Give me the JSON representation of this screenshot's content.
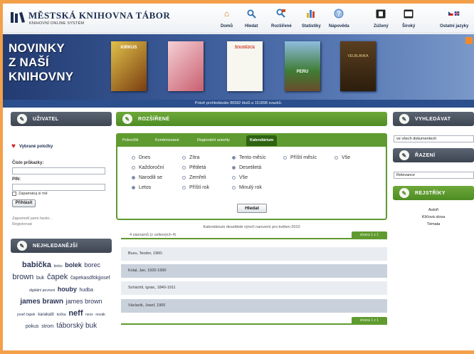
{
  "header": {
    "title": "MĚSTSKÁ KNIHOVNA TÁBOR",
    "subtitle": "KNIHOVNÍ ONLINE SYSTÉM",
    "nav": [
      {
        "label": "Domů",
        "icon": "home-icon"
      },
      {
        "label": "Hledat",
        "icon": "magnifier-icon"
      },
      {
        "label": "Rozšířené",
        "icon": "advanced-search-icon"
      },
      {
        "label": "Statistiky",
        "icon": "statistics-icon"
      },
      {
        "label": "Nápověda",
        "icon": "help-icon"
      },
      {
        "label": "Zúžený",
        "icon": "narrow-layout-icon"
      },
      {
        "label": "Široký",
        "icon": "wide-layout-icon"
      },
      {
        "label": "Ostatní jazyky",
        "icon": "language-flags-icon"
      }
    ]
  },
  "banner": {
    "title_lines": [
      "NOVINKY",
      "Z NAŠÍ",
      "KNIHOVNY"
    ],
    "covers": [
      {
        "title": "KIRKUS",
        "color": "#c4a03a"
      },
      {
        "title": "",
        "color": "#e8a2ad"
      },
      {
        "title": "ŠOUDĚDCE",
        "color": "#f2f2ee"
      },
      {
        "title": "PERU",
        "color": "#4c8f3e"
      },
      {
        "title": "VELBLANKA",
        "color": "#7a5a2e"
      }
    ],
    "stats": "Právě prohledáváte 86582 titulů a 151898 svazků."
  },
  "user": {
    "heading": "UŽIVATEL",
    "favorites": "Vybrané položky",
    "card_label": "Číslo průkazky:",
    "pin_label": "PIN:",
    "remember": "Zapamatuj si mě",
    "login_button": "Přihlásit",
    "forgot": "Zapomněl jsem heslo...",
    "register": "Registrovat"
  },
  "popular": {
    "heading": "NEJHLEDANĚJŠÍ",
    "tags": [
      {
        "text": "babička",
        "size": 11,
        "bold": true
      },
      {
        "text": "binko",
        "size": 5,
        "bold": false
      },
      {
        "text": "bolek",
        "size": 9,
        "bold": true
      },
      {
        "text": "borec",
        "size": 9,
        "bold": false
      },
      {
        "text": "brown",
        "size": 11,
        "bold": false
      },
      {
        "text": "buk",
        "size": 7,
        "bold": false
      },
      {
        "text": "čapek",
        "size": 11,
        "bold": false
      },
      {
        "text": "čapekasdfökjjosef",
        "size": 7,
        "bold": false
      },
      {
        "text": "digitální pevnost",
        "size": 5,
        "bold": false
      },
      {
        "text": "houby",
        "size": 9,
        "bold": true
      },
      {
        "text": "hudba",
        "size": 7,
        "bold": false
      },
      {
        "text": "james brawn",
        "size": 10,
        "bold": true
      },
      {
        "text": "james brown",
        "size": 9,
        "bold": false
      },
      {
        "text": "josef čapek",
        "size": 5,
        "bold": false
      },
      {
        "text": "karakatit",
        "size": 6,
        "bold": false
      },
      {
        "text": "kočka",
        "size": 5,
        "bold": false
      },
      {
        "text": "neff",
        "size": 11,
        "bold": true
      },
      {
        "text": "nevs",
        "size": 5,
        "bold": false
      },
      {
        "text": "novák",
        "size": 5,
        "bold": false
      },
      {
        "text": "pokus",
        "size": 7,
        "bold": false
      },
      {
        "text": "strom",
        "size": 7,
        "bold": false
      },
      {
        "text": "táborský buk",
        "size": 10,
        "bold": false
      }
    ]
  },
  "advanced": {
    "heading": "ROZŠÍŘENÉ",
    "tabs": [
      "Pokročilé",
      "Kombinované",
      "Regionální autority",
      "Kalendárium"
    ],
    "active_tab": 3,
    "options": {
      "c1": [
        "Dnes",
        "Každoroční",
        "Narodili se",
        "Letos"
      ],
      "c2": [
        "Zítra",
        "Pětiletá",
        "Zemřeli",
        "Příští rok"
      ],
      "c3": [
        "Tento měsíc",
        "Desetiletá",
        "Vše",
        "Minulý rok"
      ],
      "c4": [
        "Příští měsíc"
      ],
      "c5": [
        "Vše"
      ]
    },
    "selected": [
      "Narodili se",
      "Letos",
      "Tento měsíc",
      "Desetiletá"
    ],
    "search_button": "Hledat"
  },
  "results": {
    "caption": "Kalendárium desetileté výročí narození pro květen 2010",
    "count": "4 záznamů (z celkových 4)",
    "pager": "strana 1 z 1",
    "rows": [
      "Buzu, Teodor, 1960-",
      "Kolal, Jan, 1920-1990",
      "Schächtl, Ignác, 1840-1911",
      "Václavík, Josef, 1900"
    ]
  },
  "right": {
    "search_heading": "VYHLEDÁVAT",
    "search_scope": "ve všech dokumentech",
    "sort_heading": "ŘAZENÍ",
    "sort_value": "Relevance",
    "registers_heading": "REJSTŘÍKY",
    "registers": [
      "Autoři",
      "Klíčová slova",
      "Témata"
    ]
  }
}
